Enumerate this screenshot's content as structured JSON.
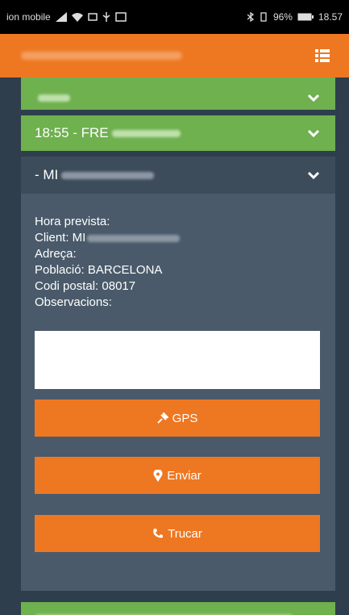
{
  "status_bar": {
    "carrier": "ion mobile",
    "battery": "96%",
    "time": "18.57"
  },
  "navbar": {
    "menu_icon": "list-menu-icon"
  },
  "deliveries": [
    {
      "time_prefix": "",
      "color": "#6fb04f",
      "icon": "chevron-down-icon"
    },
    {
      "time_prefix": "18:55 - FRE",
      "color": "#6fb04f",
      "icon": "chevron-down-icon"
    },
    {
      "time_prefix": "- MI",
      "color": "#3d4c5a",
      "icon": "chevron-down-icon"
    }
  ],
  "details": {
    "hora_prevista": "Hora prevista:",
    "client": "Client: MI",
    "adreca": "Adreça:",
    "poblacio": "Població: BARCELONA",
    "codi_postal": "Codi postal: 08017",
    "observacions": "Observacions:",
    "observacions_value": ""
  },
  "buttons": {
    "gps": "GPS",
    "enviar": "Enviar",
    "trucar": "Trucar"
  },
  "colors": {
    "accent": "#ee7722",
    "delivered": "#6fb04f",
    "panel": "#4a5a6a",
    "background": "#2f3e4c"
  }
}
